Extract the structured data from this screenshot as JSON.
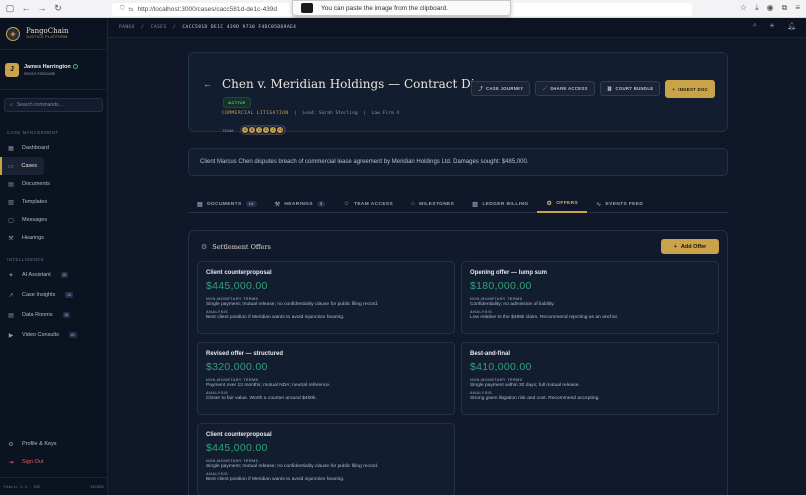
{
  "browser": {
    "url": "http://localhost:3000/cases/cacc581d-de1c-439d",
    "toast": "You can paste the image from the clipboard."
  },
  "brand": {
    "name": "PangoChain",
    "sub": "JUSTICE PLATFORM"
  },
  "user": {
    "initial": "J",
    "name": "James Harrington",
    "role": "Senior Associate"
  },
  "search": {
    "placeholder": "Search commands..."
  },
  "sidebar": {
    "section_case": "CASE MANAGEMENT",
    "items": [
      {
        "label": "Dashboard",
        "icon": "grid-icon"
      },
      {
        "label": "Cases",
        "icon": "folder-icon"
      },
      {
        "label": "Documents",
        "icon": "document-icon"
      },
      {
        "label": "Templates",
        "icon": "template-icon"
      },
      {
        "label": "Messages",
        "icon": "message-icon"
      },
      {
        "label": "Hearings",
        "icon": "gavel-icon"
      }
    ],
    "section_ai": "INTELLIGENCE",
    "ai_items": [
      {
        "label": "AI Assistant",
        "tag": "AI"
      },
      {
        "label": "Case Insights",
        "tag": "AI"
      },
      {
        "label": "Data Rooms",
        "tag": "AI"
      },
      {
        "label": "Video Consults",
        "tag": "AI"
      }
    ],
    "profile": "Profile & Keys",
    "signout": "Sign Out",
    "version_left": "Fabric 2.4 · E2E",
    "version_right": "SECURE"
  },
  "breadcrumb": {
    "a": "PANGO",
    "b": "CASES",
    "c": "CACC581D DE1C 439D 9730 F4DC05D69AE4"
  },
  "case": {
    "title": "Chen v. Meridian Holdings — Contract Di...",
    "status": "ACTIVE",
    "type": "COMMERCIAL LITIGATION",
    "lead": "Lead: Sarah Sterling",
    "firm": "Law Firm 4",
    "team_label": "TEAM:",
    "team": [
      "A",
      "B",
      "C",
      "D",
      "J",
      "+1"
    ]
  },
  "actions": {
    "journey": "CASE JOURNEY",
    "share": "SHARE ACCESS",
    "bundle": "COURT BUNDLE",
    "ingest": "INGEST DOC"
  },
  "summary": "Client Marcus Chen disputes breach of commercial lease agreement by Meridian Holdings Ltd. Damages sought: $485,000.",
  "tabs": [
    {
      "label": "DOCUMENTS",
      "badge": "14"
    },
    {
      "label": "HEARINGS",
      "badge": "5"
    },
    {
      "label": "TEAM ACCESS",
      "badge": ""
    },
    {
      "label": "MILESTONES",
      "badge": ""
    },
    {
      "label": "LEDGER BILLING",
      "badge": ""
    },
    {
      "label": "OFFERS",
      "badge": ""
    },
    {
      "label": "EVENTS FEED",
      "badge": ""
    }
  ],
  "offers": {
    "title": "Settlement Offers",
    "add": "Add Offer",
    "term_label": "NON-MONETARY TERMS",
    "analysis_label": "ANALYSIS",
    "cards": [
      {
        "title": "Client counterproposal",
        "amount": "$445,000.00",
        "terms": "Single payment; mutual release; no confidentiality clause for public filing record.",
        "analysis": "Best client position if Meridian wants to avoid injunction hearing."
      },
      {
        "title": "Opening offer — lump sum",
        "amount": "$180,000.00",
        "terms": "Confidentiality; no admission of liability.",
        "analysis": "Low relative to the $485k claim. Recommend rejecting as an anchor."
      },
      {
        "title": "Revised offer — structured",
        "amount": "$320,000.00",
        "terms": "Payment over 12 months; mutual NDA; neutral reference.",
        "analysis": "Closer to fair value. Worth a counter around $400k."
      },
      {
        "title": "Best-and-final",
        "amount": "$410,000.00",
        "terms": "Single payment within 30 days; full mutual release.",
        "analysis": "Strong given litigation risk and cost. Recommend accepting."
      },
      {
        "title": "Client counterproposal",
        "amount": "$445,000.00",
        "terms": "Single payment; mutual release; no confidentiality clause for public filing record.",
        "analysis": "Best client position if Meridian wants to avoid injunction hearing."
      }
    ]
  }
}
